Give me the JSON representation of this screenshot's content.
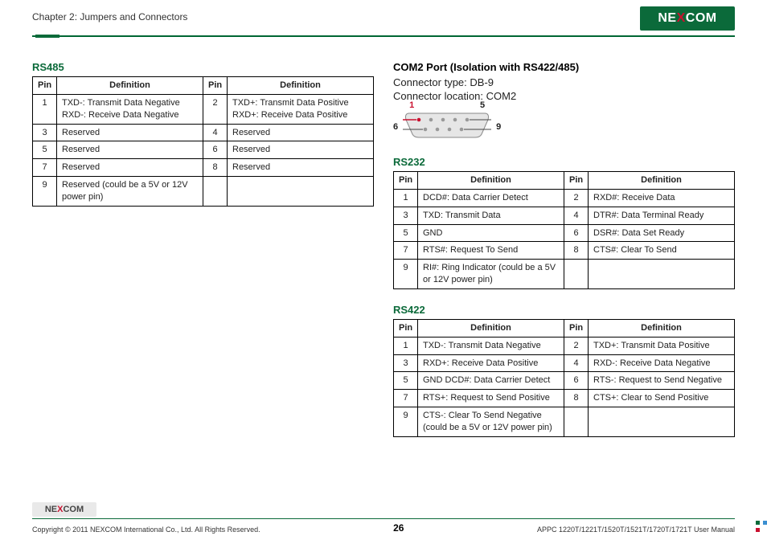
{
  "header": {
    "chapter": "Chapter 2: Jumpers and Connectors",
    "logo_part1": "NE",
    "logo_x": "X",
    "logo_part2": "COM"
  },
  "left": {
    "rs485": {
      "title": "RS485",
      "head_pin": "Pin",
      "head_def": "Definition",
      "rows": [
        {
          "p1": "1",
          "d1": "TXD-: Transmit Data Negative\nRXD-: Receive Data Negative",
          "p2": "2",
          "d2": "TXD+: Transmit Data Positive\nRXD+: Receive Data Positive"
        },
        {
          "p1": "3",
          "d1": "Reserved",
          "p2": "4",
          "d2": "Reserved"
        },
        {
          "p1": "5",
          "d1": "Reserved",
          "p2": "6",
          "d2": "Reserved"
        },
        {
          "p1": "7",
          "d1": "Reserved",
          "p2": "8",
          "d2": "Reserved"
        },
        {
          "p1": "9",
          "d1": "Reserved (could be a 5V or 12V power pin)",
          "p2": "",
          "d2": ""
        }
      ]
    }
  },
  "right": {
    "port_title": "COM2 Port (Isolation with RS422/485)",
    "conn_type": "Connector type: DB-9",
    "conn_loc": "Connector location: COM2",
    "diagram": {
      "l1": "1",
      "l5": "5",
      "l6": "6",
      "l9": "9"
    },
    "rs232": {
      "title": "RS232",
      "head_pin": "Pin",
      "head_def": "Definition",
      "rows": [
        {
          "p1": "1",
          "d1": "DCD#: Data Carrier Detect",
          "p2": "2",
          "d2": "RXD#: Receive Data"
        },
        {
          "p1": "3",
          "d1": "TXD: Transmit Data",
          "p2": "4",
          "d2": "DTR#: Data Terminal Ready"
        },
        {
          "p1": "5",
          "d1": "GND",
          "p2": "6",
          "d2": "DSR#: Data Set Ready"
        },
        {
          "p1": "7",
          "d1": "RTS#: Request To Send",
          "p2": "8",
          "d2": "CTS#: Clear To Send"
        },
        {
          "p1": "9",
          "d1": "RI#: Ring Indicator (could be a 5V or 12V power pin)",
          "p2": "",
          "d2": ""
        }
      ]
    },
    "rs422": {
      "title": "RS422",
      "head_pin": "Pin",
      "head_def": "Definition",
      "rows": [
        {
          "p1": "1",
          "d1": "TXD-: Transmit Data Negative",
          "p2": "2",
          "d2": "TXD+: Transmit Data Positive"
        },
        {
          "p1": "3",
          "d1": "RXD+: Receive Data Positive",
          "p2": "4",
          "d2": "RXD-: Receive Data Negative"
        },
        {
          "p1": "5",
          "d1": "GND DCD#: Data Carrier Detect",
          "p2": "6",
          "d2": "RTS-: Request to Send Negative"
        },
        {
          "p1": "7",
          "d1": "RTS+: Request to Send Positive",
          "p2": "8",
          "d2": "CTS+: Clear to Send Positive"
        },
        {
          "p1": "9",
          "d1": "CTS-: Clear To Send Negative (could be a 5V or 12V power pin)",
          "p2": "",
          "d2": ""
        }
      ]
    }
  },
  "footer": {
    "logo_part1": "NE",
    "logo_x": "X",
    "logo_part2": "COM",
    "copyright": "Copyright © 2011 NEXCOM International Co., Ltd. All Rights Reserved.",
    "page": "26",
    "manual": "APPC 1220T/1221T/1520T/1521T/1720T/1721T User Manual"
  }
}
